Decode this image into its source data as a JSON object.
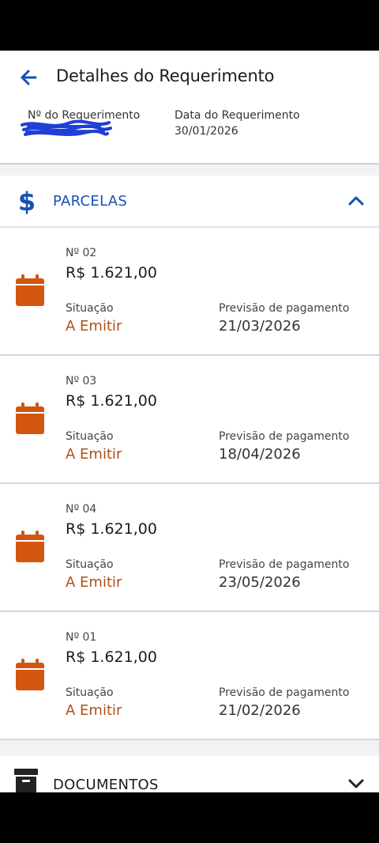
{
  "header": {
    "title": "Detalhes do Requerimento",
    "request_number_label": "Nº do Requerimento",
    "request_date_label": "Data do Requerimento",
    "request_date": "30/01/2026"
  },
  "parcelas_section": {
    "label": "PARCELAS",
    "expanded": true,
    "accent": "#1351b4"
  },
  "parcelas": [
    {
      "number": "Nº 02",
      "amount": "R$ 1.621,00",
      "status_label": "Situação",
      "status": "A Emitir",
      "payment_label": "Previsão de pagamento",
      "payment_date": "21/03/2026"
    },
    {
      "number": "Nº 03",
      "amount": "R$ 1.621,00",
      "status_label": "Situação",
      "status": "A Emitir",
      "payment_label": "Previsão de pagamento",
      "payment_date": "18/04/2026"
    },
    {
      "number": "Nº 04",
      "amount": "R$ 1.621,00",
      "status_label": "Situação",
      "status": "A Emitir",
      "payment_label": "Previsão de pagamento",
      "payment_date": "23/05/2026"
    },
    {
      "number": "Nº 01",
      "amount": "R$ 1.621,00",
      "status_label": "Situação",
      "status": "A Emitir",
      "payment_label": "Previsão de pagamento",
      "payment_date": "21/02/2026"
    }
  ],
  "documentos_section": {
    "label": "DOCUMENTOS",
    "expanded": false
  },
  "icons": {
    "back": "arrow-left-icon",
    "parcelas": "dollar-icon",
    "collapse": "chevron-up-icon",
    "parcel": "calendar-icon",
    "documentos": "archive-box-icon",
    "expand": "chevron-down-icon"
  },
  "colors": {
    "accent_blue": "#1351b4",
    "status_orange": "#b0501a",
    "calendar_orange": "#d2560f"
  }
}
